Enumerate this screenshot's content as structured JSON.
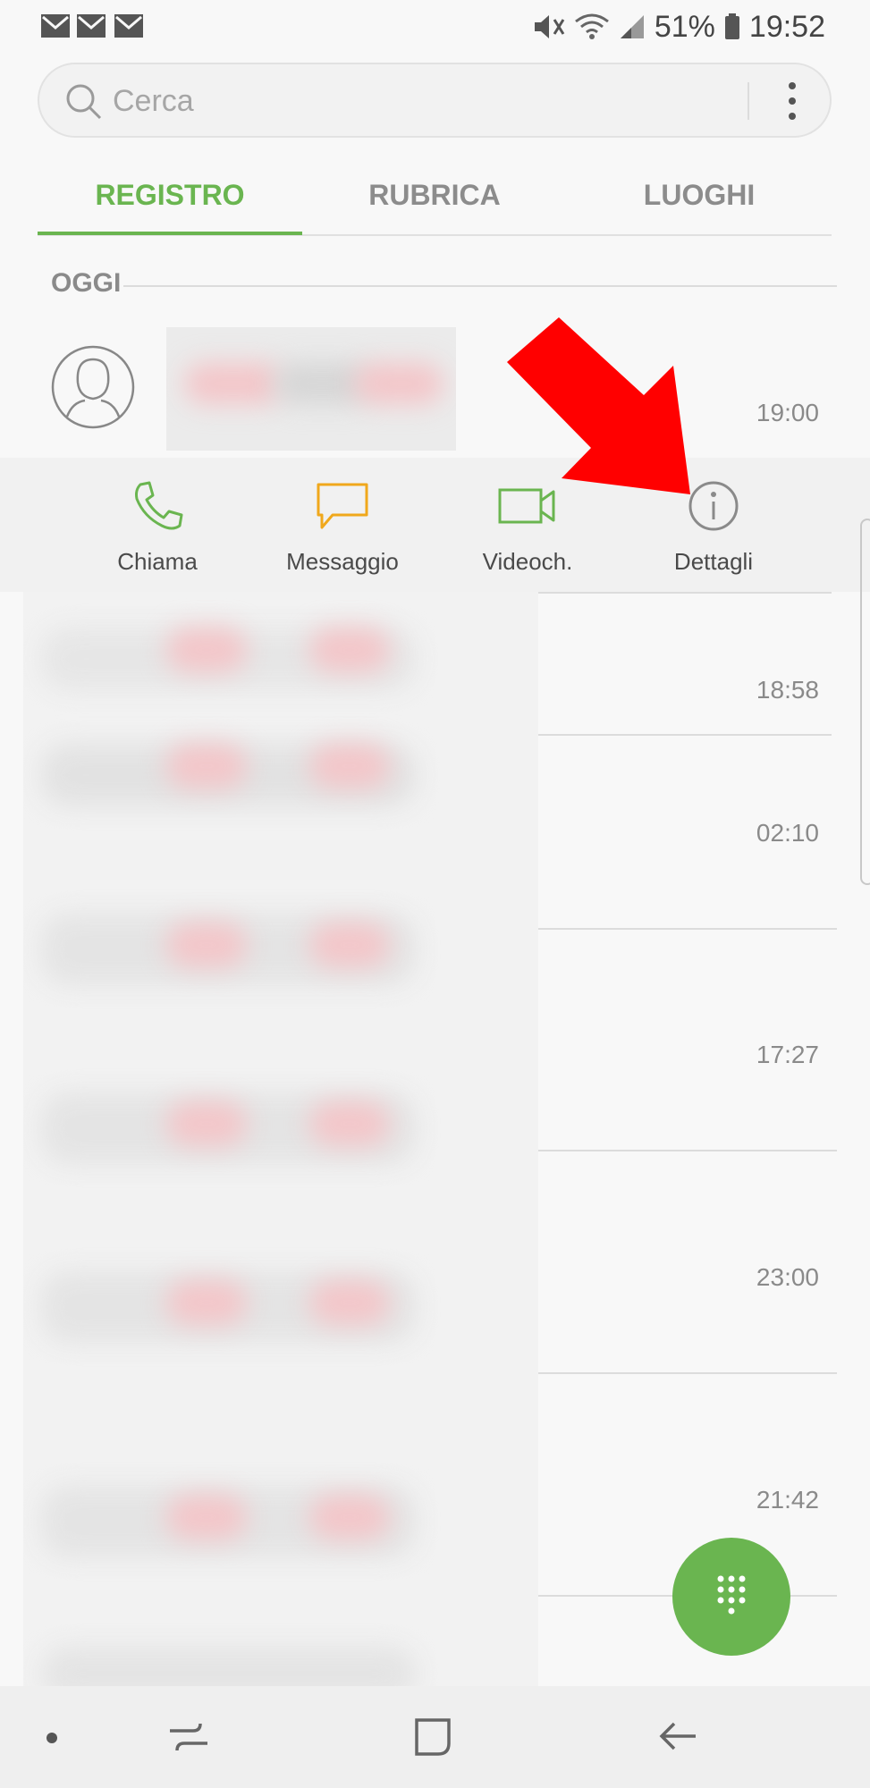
{
  "status_bar": {
    "battery_percent": "51%",
    "time": "19:52"
  },
  "search": {
    "placeholder": "Cerca"
  },
  "tabs": [
    {
      "label": "REGISTRO",
      "active": true
    },
    {
      "label": "RUBRICA",
      "active": false
    },
    {
      "label": "LUOGHI",
      "active": false
    }
  ],
  "section": {
    "title": "OGGI"
  },
  "call_log": {
    "times": [
      "19:00",
      "18:58",
      "02:10",
      "17:27",
      "23:00",
      "21:42"
    ]
  },
  "actions": [
    {
      "label": "Chiama",
      "icon": "phone-icon",
      "color": "#6ab550"
    },
    {
      "label": "Messaggio",
      "icon": "message-icon",
      "color": "#f0a81c"
    },
    {
      "label": "Videoch.",
      "icon": "video-icon",
      "color": "#6ab550"
    },
    {
      "label": "Dettagli",
      "icon": "info-icon",
      "color": "#8a8a8a"
    }
  ],
  "colors": {
    "accent": "#6ab550",
    "arrow": "#ff0000"
  }
}
